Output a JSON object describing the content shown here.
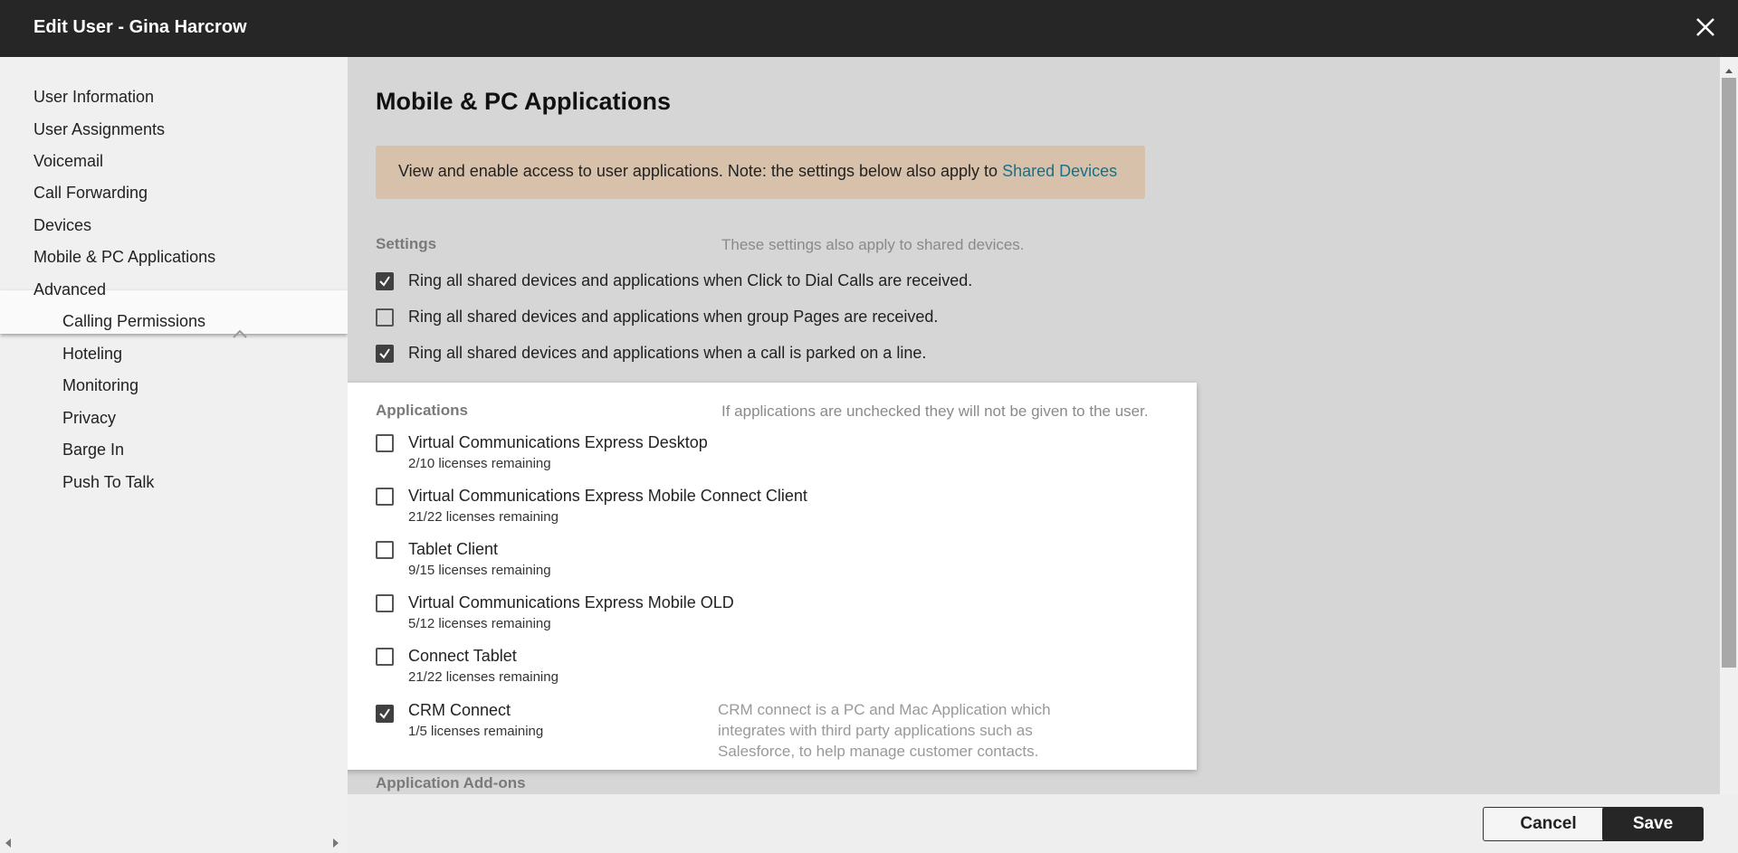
{
  "window": {
    "title": "Edit User - Gina Harcrow",
    "close_icon": "close-icon"
  },
  "sidebar": {
    "items": [
      {
        "label": "User Information"
      },
      {
        "label": "User Assignments"
      },
      {
        "label": "Voicemail"
      },
      {
        "label": "Call Forwarding"
      },
      {
        "label": "Devices"
      },
      {
        "label": "Mobile & PC Applications",
        "active": true
      },
      {
        "label": "Advanced"
      }
    ],
    "advanced_items": [
      {
        "label": "Calling Permissions"
      },
      {
        "label": "Hoteling"
      },
      {
        "label": "Monitoring"
      },
      {
        "label": "Privacy"
      },
      {
        "label": "Barge In"
      },
      {
        "label": "Push To Talk"
      }
    ]
  },
  "main": {
    "heading": "Mobile & PC Applications",
    "notice": {
      "text": "View and enable access to user applications. Note: the settings below also apply to ",
      "link": "Shared Devices",
      "background": "#d7c1aa"
    },
    "settings": {
      "label": "Settings",
      "note": "These settings also apply to shared devices.",
      "options": [
        {
          "label": "Ring all shared devices and applications when Click to Dial Calls are received.",
          "checked": true
        },
        {
          "label": "Ring all shared devices and applications when group Pages are received.",
          "checked": false
        },
        {
          "label": "Ring all shared devices and applications when a call is parked on a line.",
          "checked": true
        }
      ]
    },
    "applications": {
      "label": "Applications",
      "note": "If applications are unchecked they will not be given to the user.",
      "items": [
        {
          "label": "Virtual Communications Express Desktop",
          "licenses": "2/10 licenses remaining",
          "checked": false
        },
        {
          "label": "Virtual Communications Express Mobile Connect Client",
          "licenses": "21/22 licenses remaining",
          "checked": false
        },
        {
          "label": "Tablet Client",
          "licenses": "9/15 licenses remaining",
          "checked": false
        },
        {
          "label": "Virtual Communications Express Mobile OLD",
          "licenses": "5/12 licenses remaining",
          "checked": false
        },
        {
          "label": "Connect Tablet",
          "licenses": "21/22 licenses remaining",
          "checked": false
        },
        {
          "label": "CRM Connect",
          "licenses": "1/5 licenses remaining",
          "checked": true
        }
      ],
      "crm_note": "CRM connect is a PC and Mac Application which integrates with third party applications such as Salesforce, to help manage customer contacts."
    },
    "addons_label": "Application Add-ons"
  },
  "footer": {
    "cancel_label": "Cancel",
    "save_label": "Save"
  },
  "colors": {
    "titlebar": "#262626",
    "link": "#17708a",
    "checked": "#404040"
  }
}
